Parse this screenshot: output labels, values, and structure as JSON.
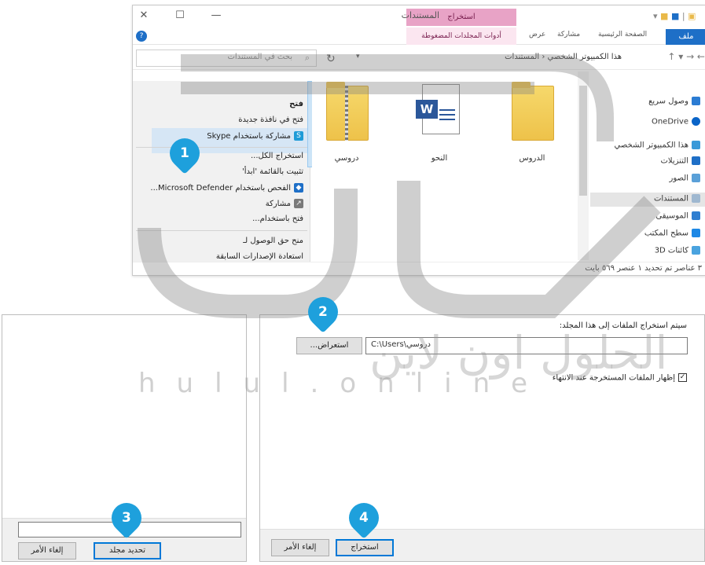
{
  "explorer": {
    "title": "المستندات",
    "context_tab": "استخراج",
    "context_tab_group": "أدوات المجلدات المضغوطة",
    "ribbon_tabs": [
      "ملف",
      "الصفحة الرئيسية",
      "مشاركة",
      "عرض"
    ],
    "search_placeholder": "بحث في المستندات",
    "breadcrumb": "هذا الكمبيوتر الشخصي ‹ المستندات",
    "context_menu": {
      "items": [
        "فتح",
        "فتح في نافذة جديدة",
        "مشاركة باستخدام Skype",
        "استخراج الكل...",
        "تثبيت بالقائمة 'ابدأ'",
        "الفحص باستخدام Microsoft Defender...",
        "مشاركة",
        "فتح باستخدام...",
        "منح حق الوصول لـ",
        "استعادة الإصدارات السابقة"
      ]
    },
    "files": [
      {
        "name": "دروسي",
        "kind": "zip"
      },
      {
        "name": "النحو",
        "kind": "word"
      },
      {
        "name": "الدروس",
        "kind": "folder"
      }
    ],
    "nav_items": [
      "وصول سريع",
      "OneDrive",
      "هذا الكمبيوتر الشخصي",
      "التنزيلات",
      "الصور",
      "المستندات",
      "الموسيقى",
      "سطح المكتب",
      "كائنات 3D"
    ],
    "status": "٣ عناصر   تم تحديد ١ عنصر ٥٦٩ بايت"
  },
  "extract_dialog": {
    "dest_label": "سيتم استخراج الملفات إلى هذا المجلد:",
    "dest_path": "C:\\Users\\دروسي",
    "browse_label": "استعراض...",
    "show_files_label": "إظهار الملفات المستخرجة عند الانتهاء",
    "show_files_checked": true,
    "extract_label": "استخراج",
    "cancel_label": "إلغاء الأمر"
  },
  "folder_dialog": {
    "select_label": "تحديد مجلد",
    "cancel_label": "إلغاء الأمر"
  },
  "steps": [
    "1",
    "2",
    "3",
    "4"
  ],
  "watermark": {
    "arabic": "الحلول اون لاين",
    "latin": "hulul.online"
  },
  "colors": {
    "accent": "#1ea0dc",
    "context_tab": "#e8a3c6",
    "selection": "#cce4f7"
  }
}
